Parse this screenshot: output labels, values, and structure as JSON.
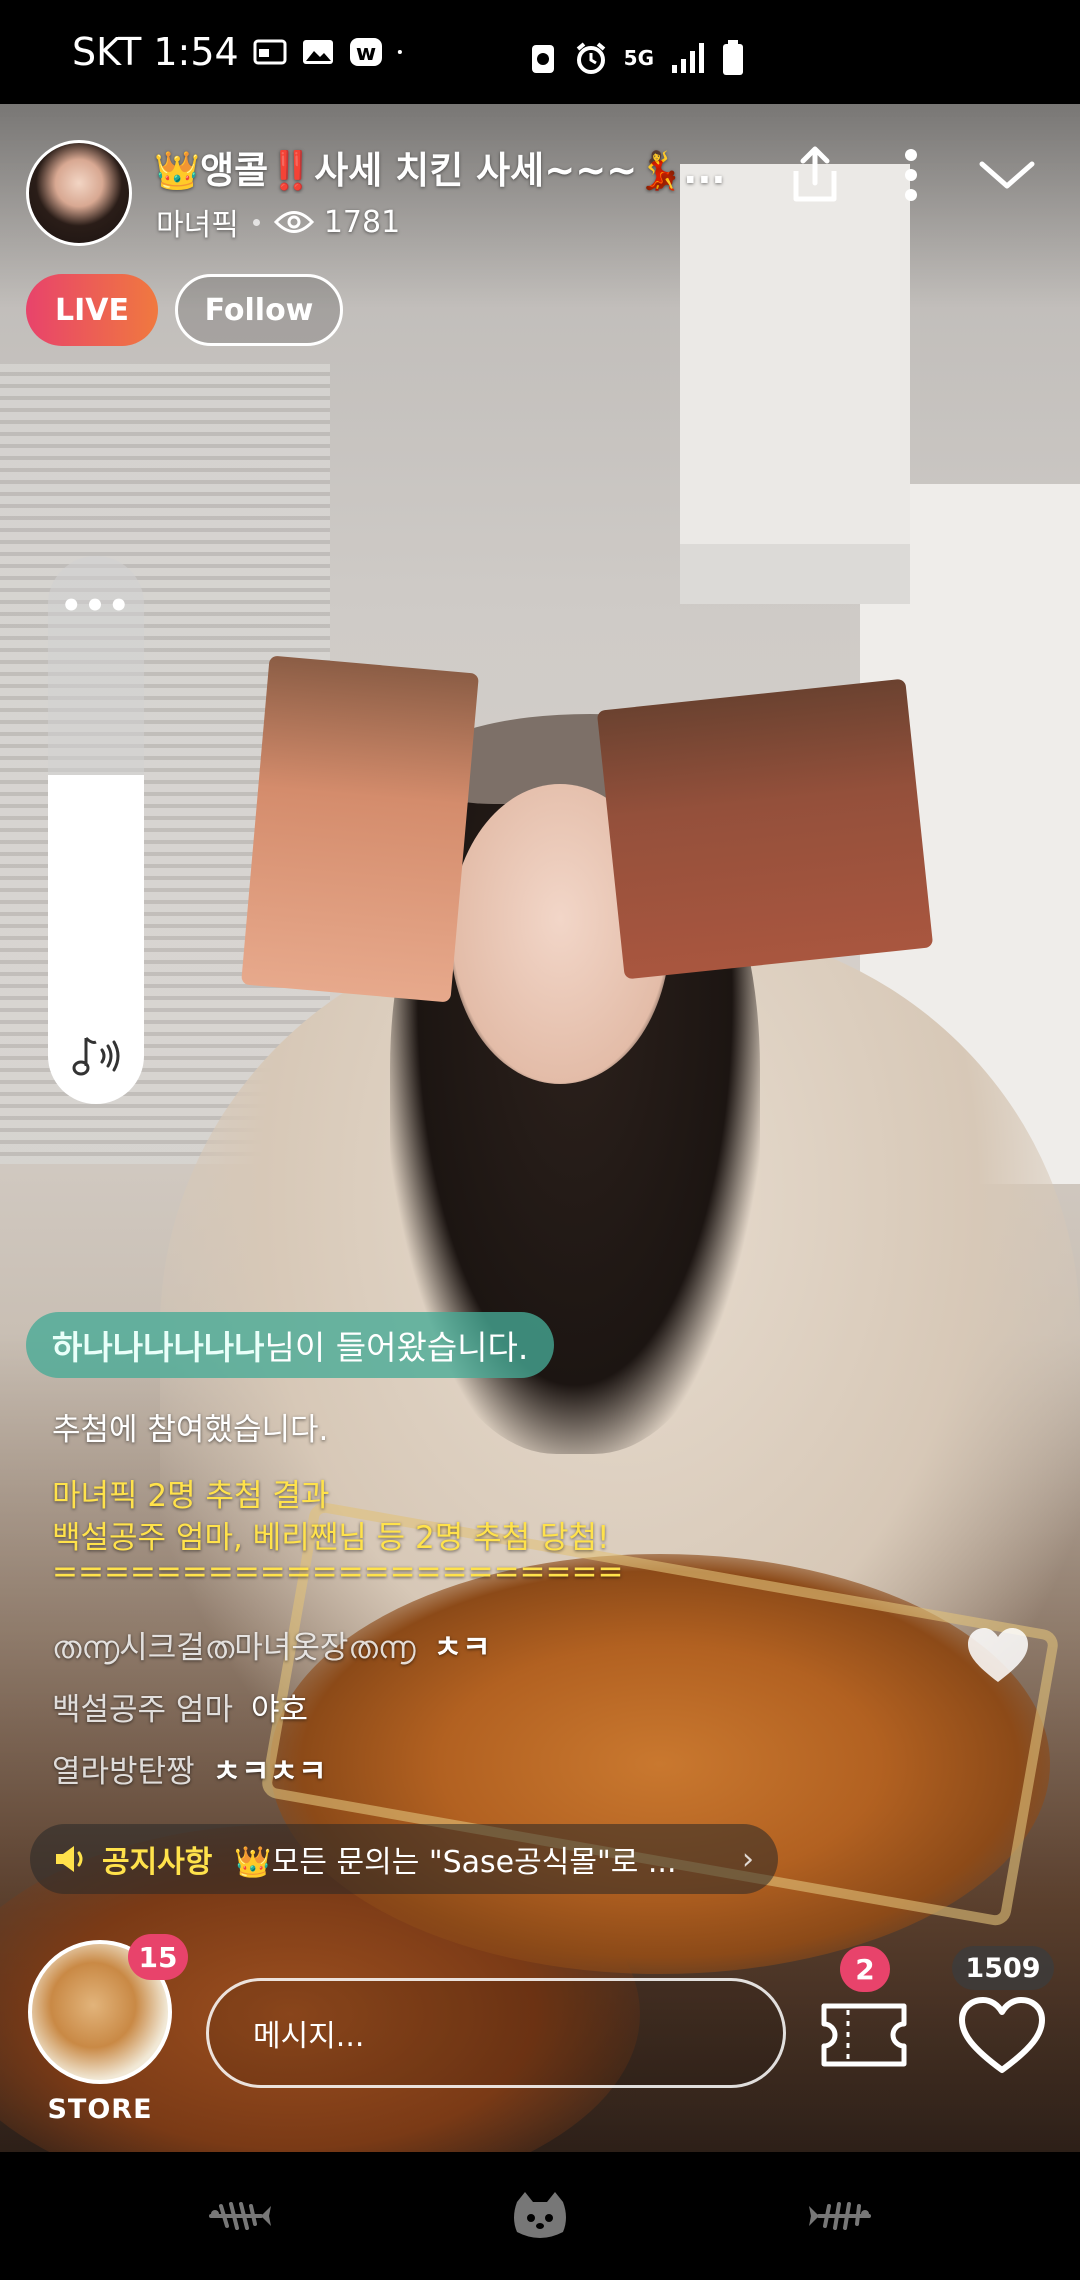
{
  "status_bar": {
    "carrier_time": "SKT 1:54",
    "network": "5G"
  },
  "stream": {
    "title": "👑앵콜‼️사세 치킨 사세~~~💃...",
    "channel": "마녀픽",
    "viewers": "1781",
    "live_label": "LIVE",
    "follow_label": "Follow"
  },
  "volume": {
    "more": "•••",
    "level": 0.6
  },
  "chat": {
    "join_name": "하나나나나나나",
    "join_suffix": "님이 들어왔습니다.",
    "lines": [
      {
        "text": "추첨에 참여했습니다."
      },
      {
        "text": "마녀픽  2명 추첨 결과"
      },
      {
        "text": "백설공주 엄마, 베리짼님 등 2명 추첨 당첨!"
      },
      {
        "text": "======================"
      }
    ],
    "messages": [
      {
        "user": "ത൬시크걸ത마녀옷장ത൬",
        "message": "ㅊㅋ"
      },
      {
        "user": "백설공주 엄마",
        "message": "야호"
      },
      {
        "user": "열라방탄짱",
        "message": "ㅊㅋㅊㅋ"
      }
    ]
  },
  "notice": {
    "label": "공지사항",
    "text": "👑모든 문의는 \"Sase공식몰\"로 ..."
  },
  "bottom": {
    "store_label": "STORE",
    "store_badge": "15",
    "message_placeholder": "메시지...",
    "ticket_badge": "2",
    "heart_count": "1509"
  },
  "colors": {
    "accent": "#e8436b",
    "live_gradient_end": "#f0793f",
    "announce_yellow": "#ffe24b",
    "user_teal": "#6fe3d2",
    "join_pill": "#46aa96"
  }
}
